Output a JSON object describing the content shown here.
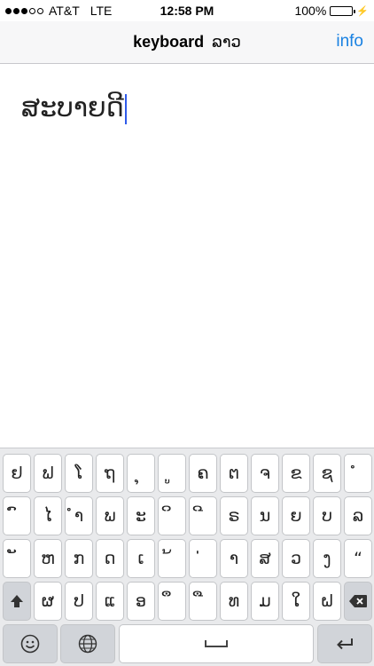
{
  "status_bar": {
    "carrier": "AT&T",
    "network": "LTE",
    "time": "12:58 PM",
    "battery": "100%",
    "signal_dots_filled": 3,
    "signal_dots_total": 5
  },
  "nav": {
    "title": "keyboard",
    "title_lao": "ລາວ",
    "info_label": "info"
  },
  "editor": {
    "text": "ສະບາຍດີ"
  },
  "keyboard": {
    "rows": [
      [
        "ຢ",
        "ຟ",
        "ໂ",
        "ຖ",
        "ຸ",
        "ູ",
        "ຄ",
        "ຕ",
        "ຈ",
        "ຂ",
        "ຊ",
        "ໍ"
      ],
      [
        "ົ",
        "ໄ",
        "ຳ",
        "ພ",
        "ະ",
        "ິ",
        "ີ",
        "ຣ",
        "ນ",
        "ຍ",
        "ບ",
        "ລ"
      ],
      [
        "ັ",
        "ຫ",
        "ກ",
        "ດ",
        "ເ",
        "້",
        "່",
        "າ",
        "ສ",
        "ວ",
        "ງ",
        "“"
      ],
      [
        "ຜ",
        "ປ",
        "ແ",
        "ອ",
        "ຶ",
        "ື",
        "ທ",
        "ມ",
        "ໃ",
        "ຝ"
      ]
    ],
    "icons": {
      "shift": "shift-icon",
      "delete": "delete-icon",
      "emoji": "emoji-icon",
      "globe": "globe-icon",
      "space": "space-icon",
      "return": "return-icon"
    }
  },
  "colors": {
    "accent": "#1a82e2",
    "caret": "#2f5bea",
    "battery": "#4cd964",
    "keyboard_bg": "#e9eaec"
  }
}
